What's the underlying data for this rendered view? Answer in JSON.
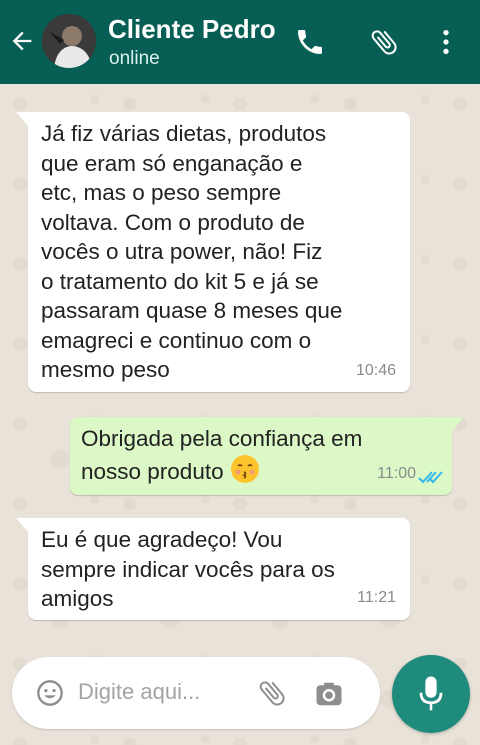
{
  "header": {
    "contact_name": "Cliente Pedro",
    "status": "online"
  },
  "messages": [
    {
      "direction": "incoming",
      "text": "Já fiz várias dietas, produtos\nque eram só enganação e\netc, mas o peso sempre\nvoltava. Com o produto de\nvocês o utra power, não! Fiz\no tratamento do kit 5 e já se\npassaram quase 8 meses que\nemagreci e continuo com o\nmesmo peso",
      "time": "10:46"
    },
    {
      "direction": "outgoing",
      "text": "Obrigada pela confiança em\nnosso produto",
      "emoji": "kissing-face-with-smiling-eyes",
      "time": "11:00",
      "read_status": "read"
    },
    {
      "direction": "incoming",
      "text": "Eu é que agradeço! Vou\nsempre indicar vocês para os\namigos",
      "time": "11:21"
    }
  ],
  "composer": {
    "placeholder": "Digite aqui..."
  },
  "icons": {
    "back": "arrow-left-icon",
    "call": "phone-icon",
    "attach": "paperclip-icon",
    "menu": "more-vertical-icon",
    "emoji": "smiley-icon",
    "camera": "camera-icon",
    "mic": "microphone-icon"
  },
  "colors": {
    "header": "#075e54",
    "outgoing_bubble": "#dcf8c6",
    "incoming_bubble": "#ffffff",
    "mic_button": "#1f8b7c",
    "read_ticks": "#34b7f1"
  }
}
